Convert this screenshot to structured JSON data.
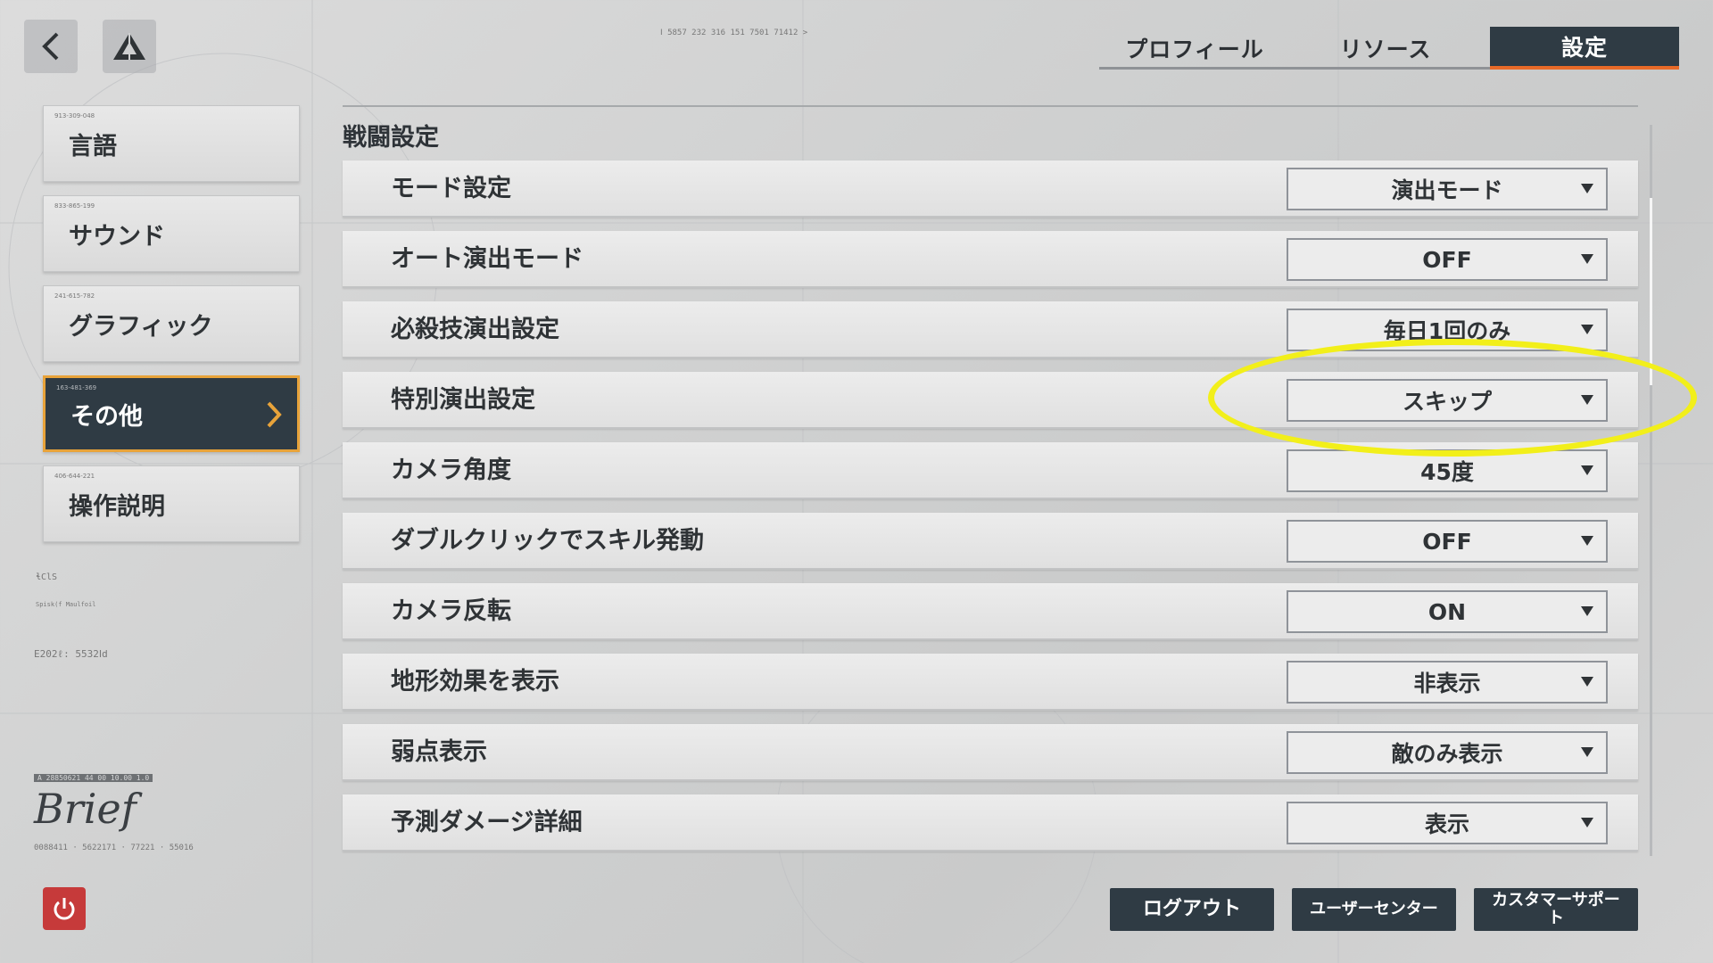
{
  "header": {
    "tabs": [
      {
        "label": "プロフィール",
        "active": false
      },
      {
        "label": "リソース",
        "active": false
      },
      {
        "label": "設定",
        "active": true
      }
    ]
  },
  "sidebar": {
    "items": [
      {
        "label": "言語",
        "code": "913-309-048"
      },
      {
        "label": "サウンド",
        "code": "833-865-199"
      },
      {
        "label": "グラフィック",
        "code": "241-615-782"
      },
      {
        "label": "その他",
        "code": "163-481-369",
        "active": true
      },
      {
        "label": "操作説明",
        "code": "406-644-221"
      }
    ]
  },
  "deco": {
    "brief": "Brief",
    "brief_code": "0088411 · 5622171 · 77221 · 55016",
    "code_line": "E202ℓ:  5532Ⅰd",
    "sign": "ɬClS",
    "sign_sub": "Spisk(f Maulfoil",
    "strip": "A 28850621 44 00 10.00 1.0",
    "topnums": "Ⅰ 5857    232    316    151    7501    71412 >"
  },
  "section": {
    "title": "戦闘設定"
  },
  "settings": [
    {
      "label": "モード設定",
      "value": "演出モード"
    },
    {
      "label": "オート演出モード",
      "value": "OFF"
    },
    {
      "label": "必殺技演出設定",
      "value": "毎日1回のみ"
    },
    {
      "label": "特別演出設定",
      "value": "スキップ"
    },
    {
      "label": "カメラ角度",
      "value": "45度"
    },
    {
      "label": "ダブルクリックでスキル発動",
      "value": "OFF"
    },
    {
      "label": "カメラ反転",
      "value": "ON"
    },
    {
      "label": "地形効果を表示",
      "value": "非表示"
    },
    {
      "label": "弱点表示",
      "value": "敵のみ表示"
    },
    {
      "label": "予測ダメージ詳細",
      "value": "表示"
    }
  ],
  "footer": {
    "logout": "ログアウト",
    "user_center": "ユーザーセンター",
    "customer_support": "カスタマーサポート"
  },
  "colors": {
    "accent": "#e86a28",
    "panel_dark": "#2f3b44",
    "highlight": "#f2ef1a",
    "power": "#c63a3a"
  }
}
